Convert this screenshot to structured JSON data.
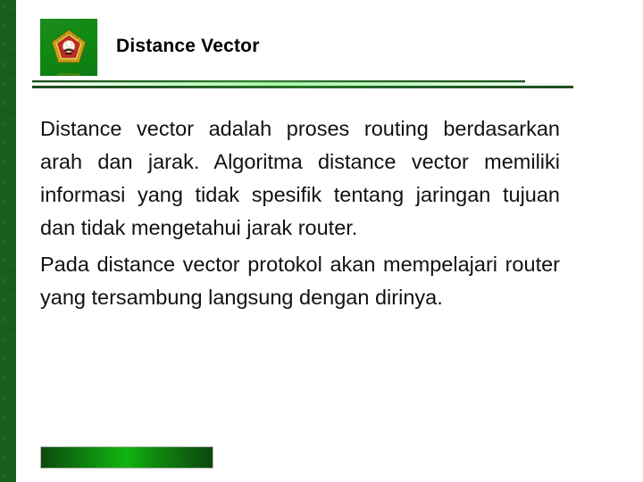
{
  "slide": {
    "title": "Distance Vector",
    "logo": {
      "icon_name": "university-emblem-logo",
      "background_color": "#108a10",
      "ring_color": "#d4a017",
      "inner_color": "#c62828"
    },
    "side_band_color": "#1b5e1b",
    "divider": {
      "top_line_color": "#214f21",
      "bottom_line_color": "#1d4d1d",
      "glow_color": "#96fa96"
    },
    "body": {
      "paragraphs": [
        "Distance vector adalah proses routing berdasarkan arah dan jarak. Algoritma distance vector memiliki informasi yang tidak spesifik tentang jaringan tujuan dan tidak mengetahui jarak router.",
        "Pada distance vector protokol akan mempelajari router yang tersambung langsung dengan dirinya."
      ]
    },
    "bottom_bar": {
      "name": "decorative-gradient-bar",
      "color_dark": "#0d4a0d",
      "color_bright": "#12b212"
    }
  }
}
